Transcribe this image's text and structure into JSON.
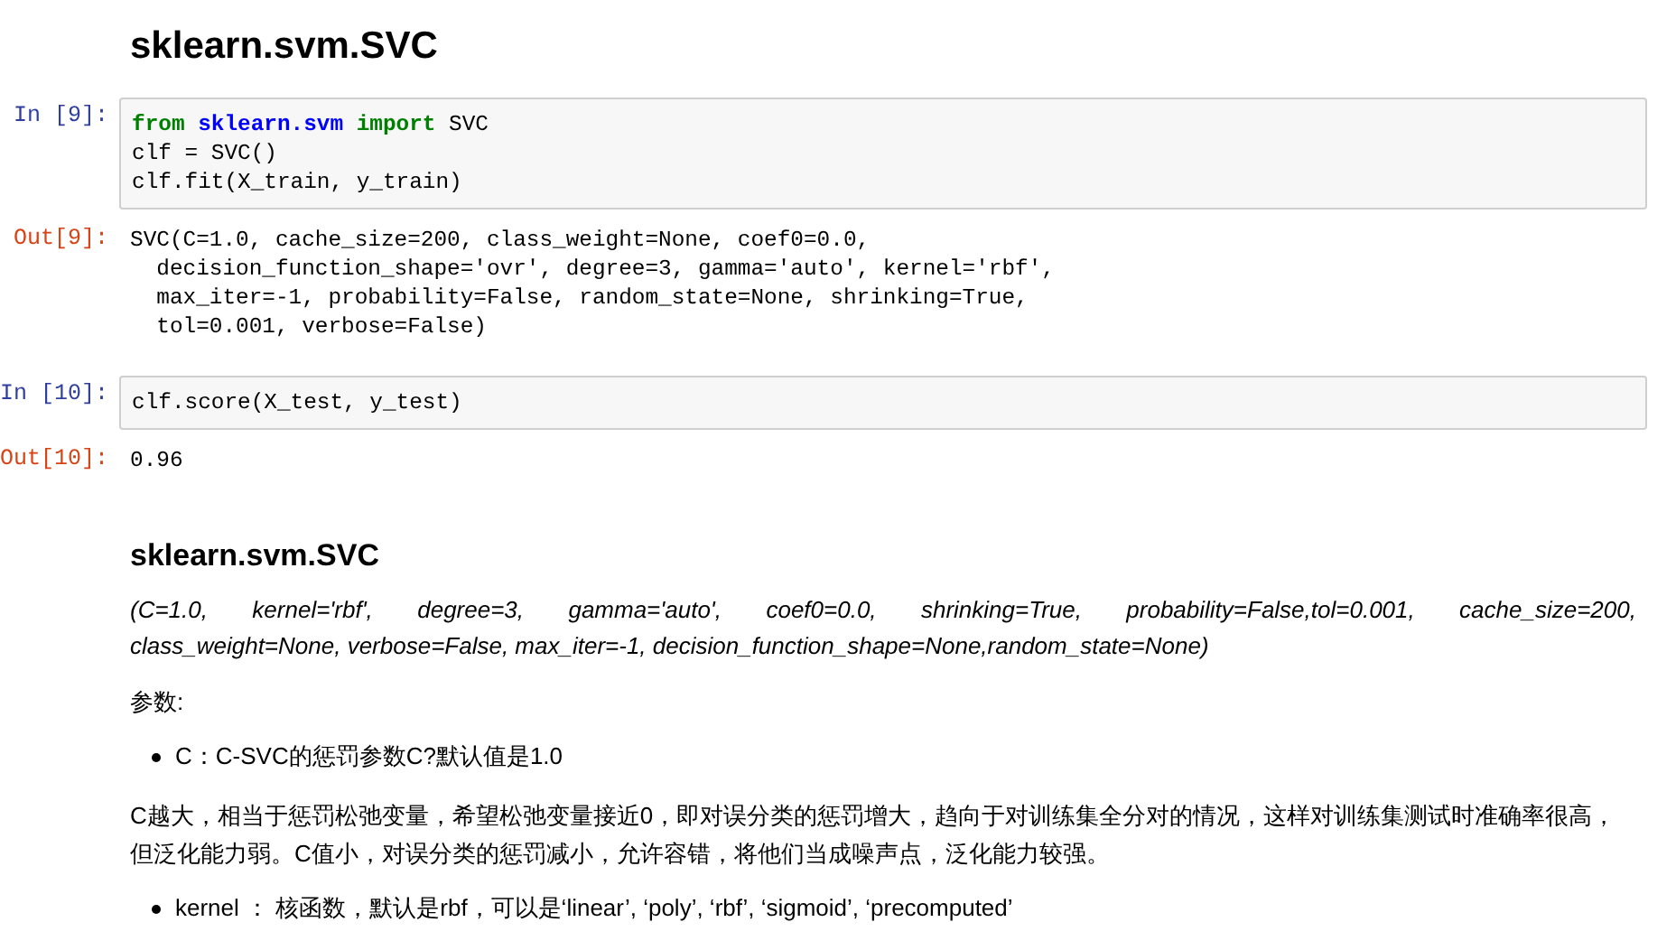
{
  "cells": [
    {
      "kind": "markdown",
      "blocks": [
        {
          "kind": "title",
          "text": "sklearn.svm.SVC"
        }
      ]
    },
    {
      "kind": "input",
      "prompt": "In [9]:",
      "lines": [
        [
          {
            "kind": "keyword",
            "text": "from"
          },
          {
            "kind": "module",
            "text": "sklearn.svm"
          },
          {
            "kind": "keyword",
            "text": "import"
          },
          {
            "kind": "plain",
            "text": "SVC"
          }
        ],
        [
          {
            "kind": "plain",
            "text": "clf = SVC()"
          }
        ],
        [
          {
            "kind": "plain",
            "text": "clf.fit(X_train, y_train)"
          }
        ]
      ]
    },
    {
      "kind": "output",
      "prompt": "Out[9]:",
      "lines": [
        "SVC(C=1.0, cache_size=200, class_weight=None, coef0=0.0,",
        "  decision_function_shape='ovr', degree=3, gamma='auto', kernel='rbf',",
        "  max_iter=-1, probability=False, random_state=None, shrinking=True,",
        "  tol=0.001, verbose=False)"
      ]
    },
    {
      "kind": "input",
      "prompt": "In [10]:",
      "lines": [
        [
          {
            "kind": "plain",
            "text": "clf.score(X_test, y_test)"
          }
        ]
      ]
    },
    {
      "kind": "output",
      "prompt": "Out[10]:",
      "lines": [
        "0.96"
      ]
    },
    {
      "kind": "markdown",
      "blocks": [
        {
          "kind": "heading",
          "text": "sklearn.svm.SVC"
        },
        {
          "kind": "signature",
          "text": "(C=1.0,   kernel='rbf',   degree=3,   gamma='auto',   coef0=0.0,   shrinking=True,   probability=False,tol=0.001,   cache_size=200, class_weight=None, verbose=False, max_iter=-1, decision_function_shape=None,random_state=None)"
        },
        {
          "kind": "paragraph",
          "text": "参数:"
        },
        {
          "kind": "bullet",
          "text": "C：C-SVC的惩罚参数C?默认值是1.0"
        },
        {
          "kind": "paragraph",
          "text": "C越大，相当于惩罚松弛变量，希望松弛变量接近0，即对误分类的惩罚增大，趋向于对训练集全分对的情况，这样对训练集测试时准确率很高，但泛化能力弱。C值小，对误分类的惩罚减小，允许容错，将他们当成噪声点，泛化能力较强。"
        },
        {
          "kind": "bullet",
          "text": "kernel ： 核函数，默认是rbf，可以是‘linear’, ‘poly’, ‘rbf’, ‘sigmoid’, ‘precomputed’"
        }
      ]
    }
  ]
}
